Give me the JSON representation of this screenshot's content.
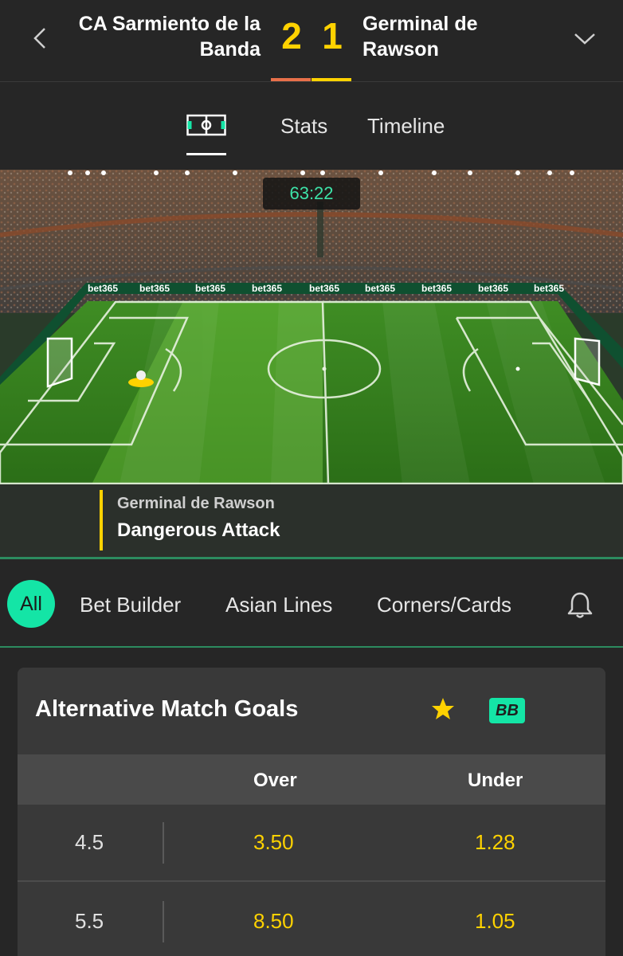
{
  "header": {
    "home_team": "CA Sarmiento de la Banda",
    "away_team": "Germinal de Rawson",
    "home_score": "2",
    "away_score": "1",
    "home_color": "#e8704a",
    "away_color": "#ffd200",
    "back_icon": "chevron-left-icon",
    "expand_icon": "chevron-down-icon"
  },
  "view_tabs": {
    "pitch_icon": "pitch-icon",
    "stats": "Stats",
    "timeline": "Timeline"
  },
  "match_view": {
    "clock": "63:22",
    "sponsor": "bet365",
    "event_team": "Germinal de Rawson",
    "event_text": "Dangerous Attack"
  },
  "market_tabs": {
    "all": "All",
    "bet_builder": "Bet Builder",
    "asian_lines": "Asian Lines",
    "corners_cards": "Corners/Cards",
    "bell_icon": "bell-icon"
  },
  "market": {
    "title": "Alternative Match Goals",
    "star_icon": "star-icon",
    "bb_badge": "BB",
    "col_over": "Over",
    "col_under": "Under",
    "rows": [
      {
        "line": "4.5",
        "over": "3.50",
        "under": "1.28"
      },
      {
        "line": "5.5",
        "over": "8.50",
        "under": "1.05"
      }
    ]
  },
  "colors": {
    "accent_green": "#14e5a6",
    "odds_yellow": "#ffd200",
    "background": "#262626"
  }
}
